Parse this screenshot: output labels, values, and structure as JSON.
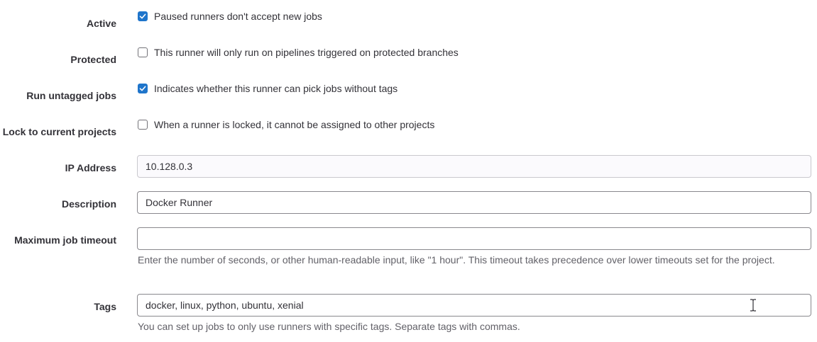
{
  "fields": {
    "active": {
      "label": "Active",
      "checked": true,
      "description": "Paused runners don't accept new jobs"
    },
    "protected": {
      "label": "Protected",
      "checked": false,
      "description": "This runner will only run on pipelines triggered on protected branches"
    },
    "run_untagged": {
      "label": "Run untagged jobs",
      "checked": true,
      "description": "Indicates whether this runner can pick jobs without tags"
    },
    "locked": {
      "label": "Lock to current projects",
      "checked": false,
      "description": "When a runner is locked, it cannot be assigned to other projects"
    },
    "ip_address": {
      "label": "IP Address",
      "value": "10.128.0.3"
    },
    "description": {
      "label": "Description",
      "value": "Docker Runner"
    },
    "max_timeout": {
      "label": "Maximum job timeout",
      "value": "",
      "help": "Enter the number of seconds, or other human-readable input, like \"1 hour\". This timeout takes precedence over lower timeouts set for the project."
    },
    "tags": {
      "label": "Tags",
      "value": "docker, linux, python, ubuntu, xenial",
      "help": "You can set up jobs to only use runners with specific tags. Separate tags with commas."
    }
  },
  "colors": {
    "checkbox_checked": "#1f75cb",
    "help_text": "#626168"
  }
}
